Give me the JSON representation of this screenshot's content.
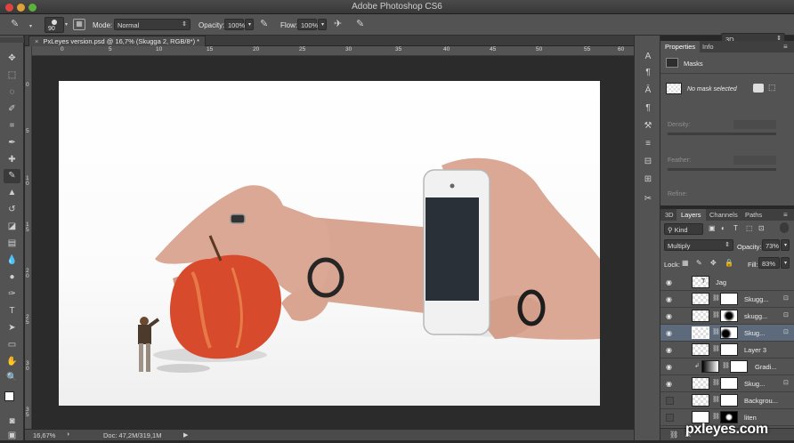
{
  "title_bar": {
    "title": "Adobe Photoshop CS6"
  },
  "options_bar": {
    "brush_size": "90",
    "mode_label": "Mode:",
    "mode_value": "Normal",
    "opacity_label": "Opacity:",
    "opacity_value": "100%",
    "flow_label": "Flow:",
    "flow_value": "100%",
    "workspace": "3D"
  },
  "document": {
    "tab_title": "PxLeyes version.psd @ 16,7% (Skugga 2, RGB/8*) *"
  },
  "ruler": {
    "top": [
      "0",
      "5",
      "10",
      "15",
      "20",
      "25",
      "30",
      "35",
      "40",
      "45",
      "50",
      "55",
      "60"
    ],
    "left": [
      "0",
      "5",
      "1\n0",
      "1\n5",
      "2\n0",
      "2\n5",
      "3\n0",
      "3\n5"
    ]
  },
  "status": {
    "zoom": "16,67%",
    "doc": "Doc: 47,2M/319,1M"
  },
  "properties_panel": {
    "tabs": [
      "Properties",
      "Info"
    ],
    "section": "Masks",
    "mask_status": "No mask selected",
    "density_label": "Density:",
    "feather_label": "Feather:",
    "refine_label": "Refine:"
  },
  "layers_panel": {
    "tabs": [
      "3D",
      "Layers",
      "Channels",
      "Paths"
    ],
    "filter_kind": "Kind",
    "blend_mode": "Multiply",
    "opacity_label": "Opacity:",
    "opacity_value": "73%",
    "lock_label": "Lock:",
    "fill_label": "Fill:",
    "fill_value": "83%",
    "layers": [
      {
        "name": "Jag"
      },
      {
        "name": "Skugg..."
      },
      {
        "name": "skugg..."
      },
      {
        "name": "Skug..."
      },
      {
        "name": "Layer 3"
      },
      {
        "name": "Gradi..."
      },
      {
        "name": "Skug..."
      },
      {
        "name": "Backgrou..."
      },
      {
        "name": "liten"
      }
    ]
  },
  "watermark": "pxleyes.com"
}
